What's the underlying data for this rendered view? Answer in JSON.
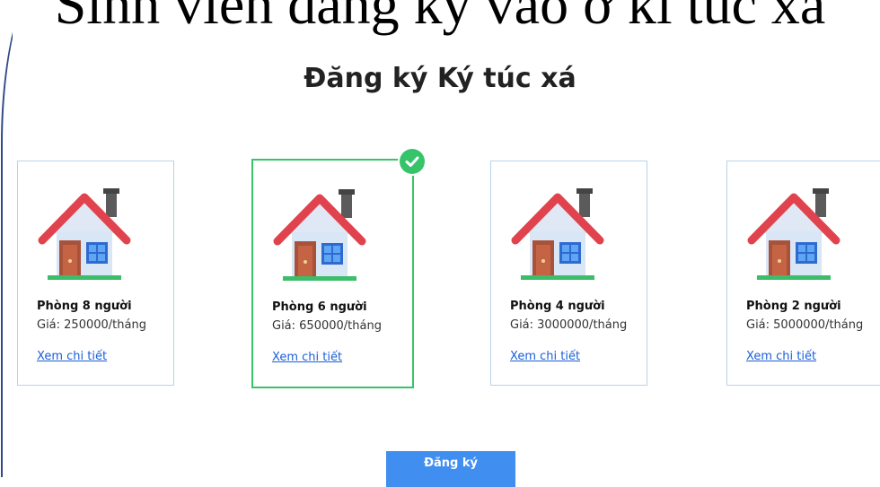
{
  "slide": {
    "title": "Sinh viên đăng ký vào ở kí túc xá"
  },
  "page": {
    "title": "Đăng ký Ký túc xá"
  },
  "rooms": [
    {
      "name": "Phòng 8 người",
      "price": "Giá: 250000/tháng",
      "link": "Xem chi tiết",
      "selected": false
    },
    {
      "name": "Phòng 6 người",
      "price": "Giá: 650000/tháng",
      "link": "Xem chi tiết",
      "selected": true
    },
    {
      "name": "Phòng 4 người",
      "price": "Giá: 3000000/tháng",
      "link": "Xem chi tiết",
      "selected": false
    },
    {
      "name": "Phòng 2 người",
      "price": "Giá: 5000000/tháng",
      "link": "Xem chi tiết",
      "selected": false
    }
  ],
  "actions": {
    "submit_label": "Đăng ký"
  },
  "icons": {
    "room": "house-icon",
    "selected": "check-circle-icon"
  },
  "colors": {
    "selected": "#36c46b",
    "link": "#1a5fd6",
    "button": "#3f8ef0",
    "card_border": "#b8d3ea"
  }
}
